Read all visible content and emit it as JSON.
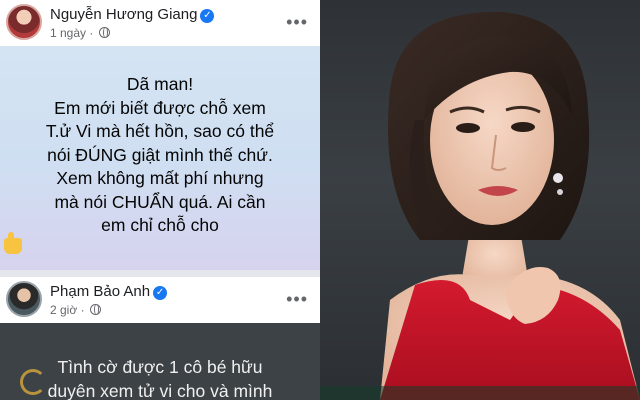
{
  "post1": {
    "author": "Nguyễn Hương Giang",
    "time": "1 ngày",
    "separator_dot": "·",
    "menu": "•••",
    "lines": [
      "Dã man!",
      "Em mới biết được chỗ xem",
      "T.ử Vi mà hết hồn, sao có thể",
      "nói ĐÚNG giật mình thế chứ.",
      "Xem không mất phí nhưng",
      "mà nói CHUẨN quá. Ai cần",
      "em chỉ chỗ cho"
    ]
  },
  "post2": {
    "author": "Phạm Bảo Anh",
    "time": "2 giờ",
    "separator_dot": "·",
    "menu": "•••",
    "lines": [
      "Tình cờ được 1 cô bé hữu",
      "duyên xem tử vi cho và mình"
    ]
  },
  "icons": {
    "verified": "verified-badge-icon",
    "privacy": "globe-icon",
    "emoji": "thumbs-up-emoji-icon"
  },
  "colors": {
    "post1_background": "#d4e4f3",
    "post2_background": "#3d4246",
    "verified": "#1877f2",
    "dress": "#c8102e"
  }
}
